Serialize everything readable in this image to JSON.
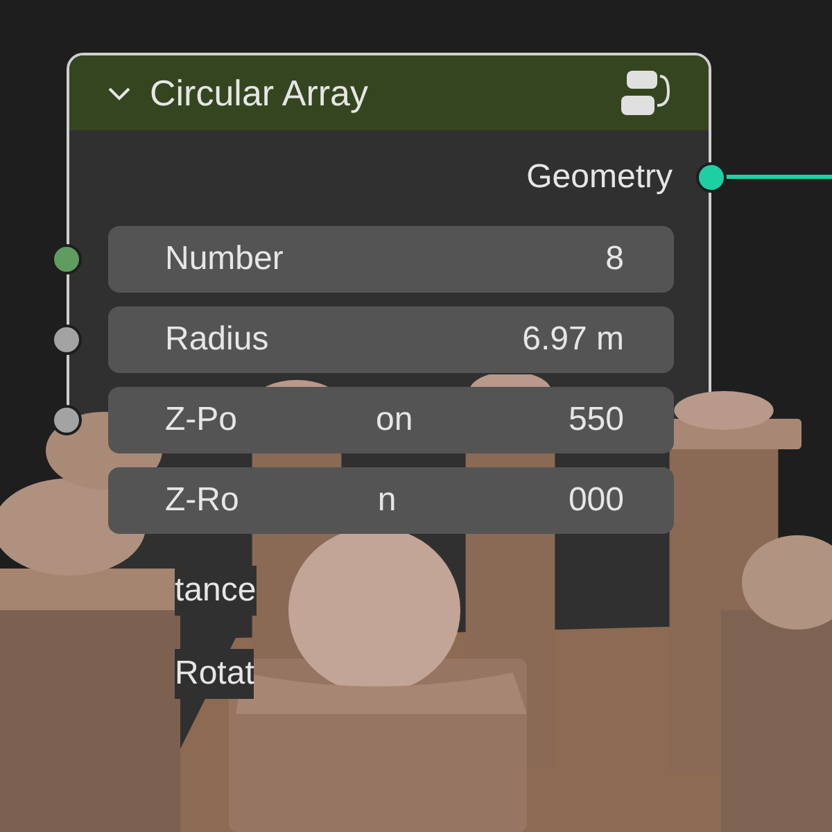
{
  "node": {
    "title": "Circular Array",
    "expanded": true,
    "outputs": [
      {
        "label": "Geometry",
        "color": "#1ecfa4"
      }
    ],
    "inputs": [
      {
        "label_parts": [
          "Number"
        ],
        "value": "8",
        "color": "#5f9c5f"
      },
      {
        "label_parts": [
          "Radius"
        ],
        "value": "6.97 m",
        "color": "#a3a3a3"
      },
      {
        "label_parts": [
          "Z-Po",
          "on"
        ],
        "value": "550",
        "color": "#a3a3a3"
      },
      {
        "label_parts": [
          "Z-Ro",
          "n"
        ],
        "value": "000"
      }
    ],
    "labels": [
      "tance",
      "Rotat"
    ]
  }
}
